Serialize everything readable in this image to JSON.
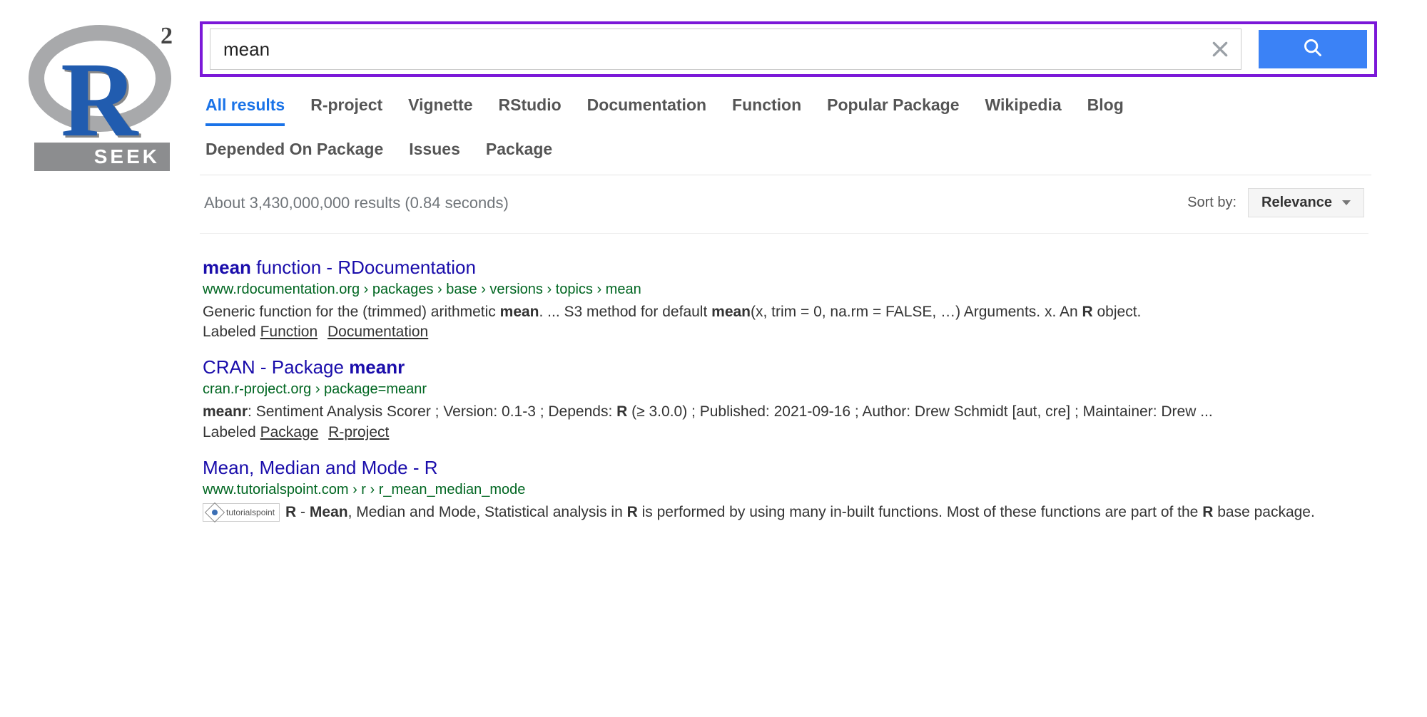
{
  "logo": {
    "seek": "SEEK",
    "sq": "2",
    "r": "R"
  },
  "search": {
    "query": "mean"
  },
  "tabs": {
    "row1": [
      "All results",
      "R-project",
      "Vignette",
      "RStudio",
      "Documentation",
      "Function",
      "Popular Package",
      "Wikipedia",
      "Blog"
    ],
    "row2": [
      "Depended On Package",
      "Issues",
      "Package"
    ],
    "active": 0
  },
  "meta": {
    "stats": "About 3,430,000,000 results (0.84 seconds)",
    "sort_label": "Sort by:",
    "sort_value": "Relevance"
  },
  "results": [
    {
      "title_html": "<b>mean</b> function - RDocumentation",
      "url": "www.rdocumentation.org › packages › base › versions › topics › mean",
      "snippet_html": "Generic function for the (trimmed) arithmetic <b>mean</b>. ... S3 method for default <b>mean</b>(x, trim = 0, na.rm = FALSE, …) Arguments. x. An <b>R</b> object.",
      "labels": [
        "Function",
        "Documentation"
      ]
    },
    {
      "title_html": "CRAN - Package <b>meanr</b>",
      "url": "cran.r-project.org › package=meanr",
      "snippet_html": "<b>meanr</b>: Sentiment Analysis Scorer ; Version: 0.1-3 ; Depends: <b>R</b> (≥ 3.0.0) ; Published: 2021-09-16 ; Author: Drew Schmidt [aut, cre] ; Maintainer: Drew ...",
      "labels": [
        "Package",
        "R-project"
      ]
    },
    {
      "title_html": "Mean, Median and Mode - R",
      "url": "www.tutorialspoint.com › r › r_mean_median_mode",
      "snippet_html": "<b>R</b> - <b>Mean</b>, Median and Mode, Statistical analysis in <b>R</b> is performed by using many in-built functions. Most of these functions are part of the <b>R</b> base package.",
      "labels": [],
      "thumb": "tutorialspoint"
    }
  ],
  "labeled_prefix": "Labeled "
}
